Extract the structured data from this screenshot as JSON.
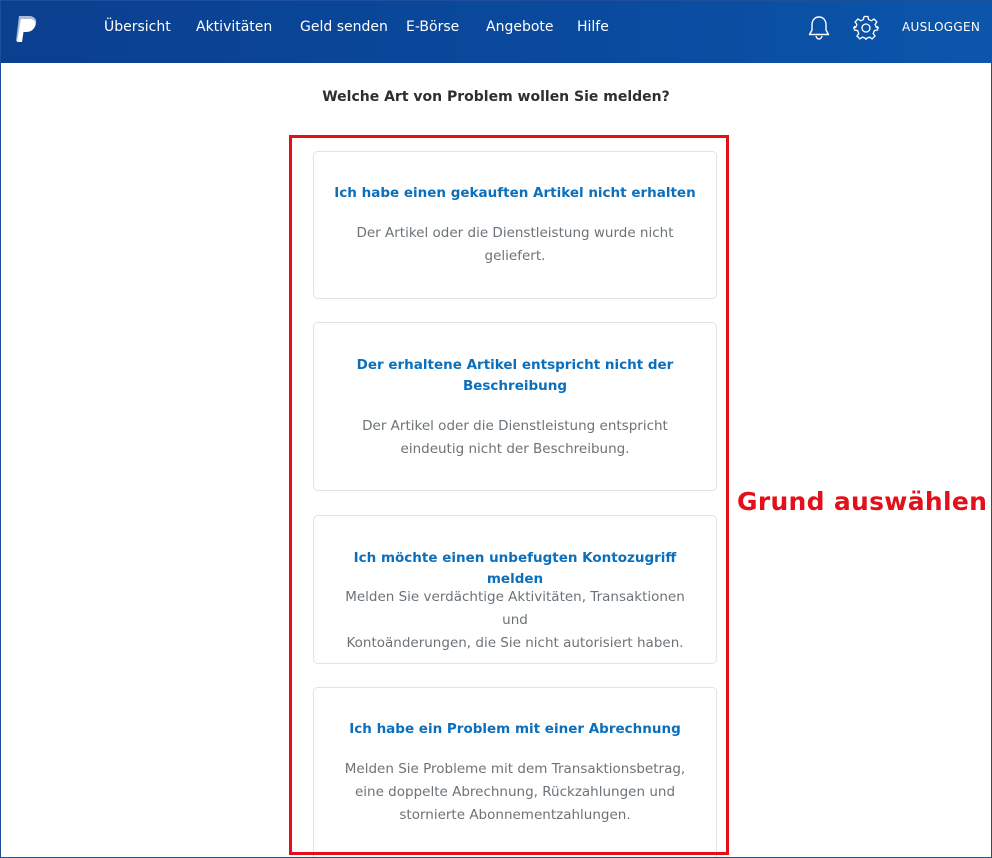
{
  "nav": {
    "items": [
      "Übersicht",
      "Aktivitäten",
      "Geld senden",
      "E-Börse",
      "Angebote",
      "Hilfe"
    ],
    "logout_label": "AUSLOGGEN",
    "logo_icon": "paypal-logo-icon",
    "bell_icon": "bell-icon",
    "settings_icon": "gear-icon"
  },
  "main": {
    "question": "Welche Art von Problem wollen Sie melden?",
    "options": [
      {
        "title": "Ich habe einen gekauften Artikel nicht erhalten",
        "desc_lines": [
          "Der Artikel oder die Dienstleistung wurde nicht",
          "geliefert."
        ]
      },
      {
        "title_lines": [
          "Der erhaltene Artikel entspricht nicht der",
          "Beschreibung"
        ],
        "desc_lines": [
          "Der Artikel oder die Dienstleistung entspricht",
          "eindeutig nicht der Beschreibung."
        ]
      },
      {
        "title": "Ich möchte einen unbefugten Kontozugriff melden",
        "desc_lines": [
          "Melden Sie verdächtige Aktivitäten, Transaktionen und",
          "Kontoänderungen, die Sie nicht autorisiert haben."
        ]
      },
      {
        "title": "Ich habe ein Problem mit einer Abrechnung",
        "desc_lines": [
          "Melden Sie Probleme mit dem Transaktionsbetrag,",
          "eine doppelte Abrechnung, Rückzahlungen und",
          "stornierte Abonnementzahlungen."
        ]
      }
    ]
  },
  "annotation": {
    "text": "Grund auswählen",
    "color": "#e3101a"
  },
  "colors": {
    "header": "#0b4a9e",
    "link": "#0b6fbc",
    "muted": "#6c7378"
  }
}
